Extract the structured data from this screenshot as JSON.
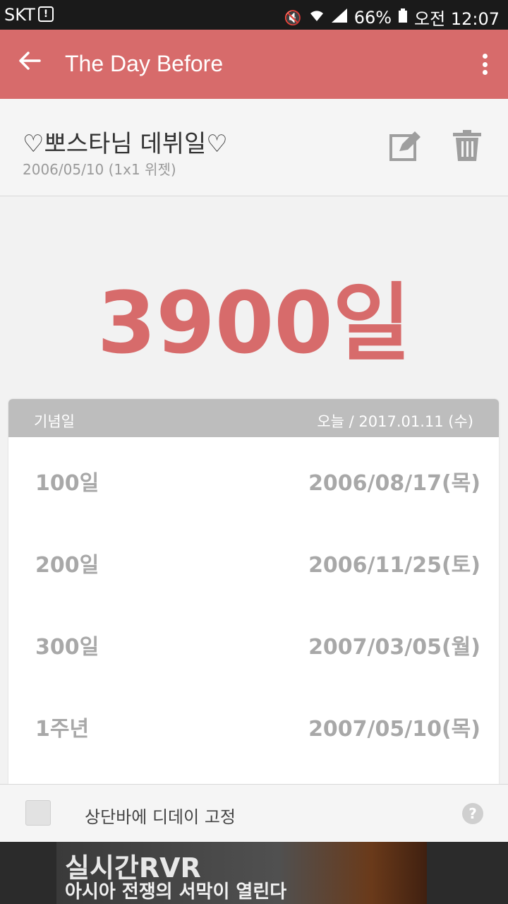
{
  "status": {
    "carrier": "SKT",
    "alert": "!",
    "battery": "66%",
    "time": "오전 12:07"
  },
  "appbar": {
    "title": "The Day Before"
  },
  "event": {
    "name": "♡뽀스타님 데뷔일♡",
    "sub": "2006/05/10 (1x1 위젯)"
  },
  "dday": "3900일",
  "table": {
    "header_left": "기념일",
    "header_right": "오늘 / 2017.01.11 (수)",
    "rows": [
      {
        "label": "100일",
        "date": "2006/08/17(목)"
      },
      {
        "label": "200일",
        "date": "2006/11/25(토)"
      },
      {
        "label": "300일",
        "date": "2007/03/05(월)"
      },
      {
        "label": "1주년",
        "date": "2007/05/10(목)"
      }
    ]
  },
  "bottom": {
    "checkbox_label": "상단바에 디데이 고정",
    "checked": false,
    "help": "?"
  },
  "ad": {
    "line1": "실시간RVR",
    "line2": "아시아 전쟁의 서막이 열린다",
    "info": "i",
    "close": "✕"
  },
  "colors": {
    "accent": "#d76b6b",
    "table_header": "#bdbdbd"
  }
}
